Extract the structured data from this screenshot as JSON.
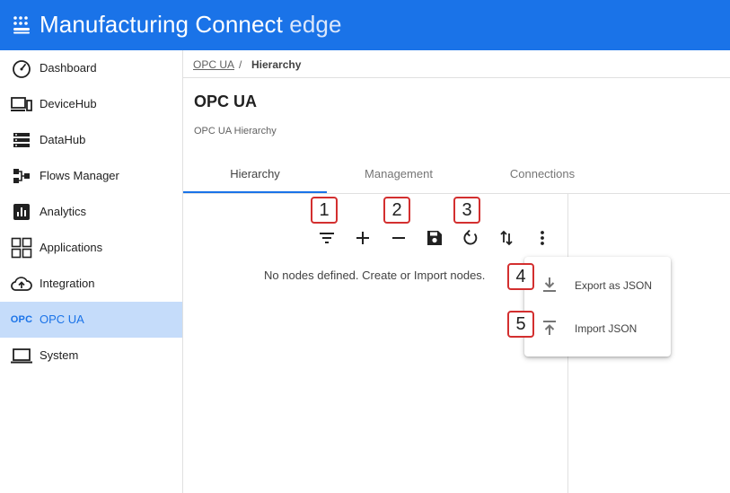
{
  "header": {
    "title_main": "Manufacturing Connect",
    "title_suffix": "edge",
    "icon": "grid-logo-icon"
  },
  "sidebar": {
    "items": [
      {
        "label": "Dashboard",
        "icon": "speedometer-icon"
      },
      {
        "label": "DeviceHub",
        "icon": "devices-icon"
      },
      {
        "label": "DataHub",
        "icon": "storage-icon"
      },
      {
        "label": "Flows Manager",
        "icon": "flow-icon"
      },
      {
        "label": "Analytics",
        "icon": "analytics-icon"
      },
      {
        "label": "Applications",
        "icon": "apps-grid-icon"
      },
      {
        "label": "Integration",
        "icon": "cloud-upload-icon"
      },
      {
        "label": "OPC UA",
        "icon_text": "OPC",
        "active": true
      },
      {
        "label": "System",
        "icon": "laptop-icon"
      }
    ]
  },
  "breadcrumb": {
    "link": "OPC UA",
    "separator": "/",
    "current": "Hierarchy"
  },
  "page": {
    "title": "OPC UA",
    "subtitle": "OPC UA Hierarchy"
  },
  "tabs": [
    {
      "label": "Hierarchy",
      "active": true
    },
    {
      "label": "Management",
      "active": false
    },
    {
      "label": "Connections",
      "active": false
    }
  ],
  "toolbar": {
    "badges": [
      "1",
      "2",
      "3"
    ],
    "icons": [
      "filter-icon",
      "add-icon",
      "remove-icon",
      "save-icon",
      "refresh-icon",
      "swap-vertical-icon",
      "more-vert-icon"
    ]
  },
  "tree": {
    "empty_message": "No nodes defined. Create or Import nodes."
  },
  "menu": {
    "items": [
      {
        "label": "Export as JSON",
        "badge": "4",
        "icon": "download-icon"
      },
      {
        "label": "Import JSON",
        "badge": "5",
        "icon": "upload-icon"
      }
    ]
  },
  "colors": {
    "primary": "#1a73e8",
    "active_nav_bg": "#c5dcfa",
    "badge_border": "#d32f2f"
  }
}
